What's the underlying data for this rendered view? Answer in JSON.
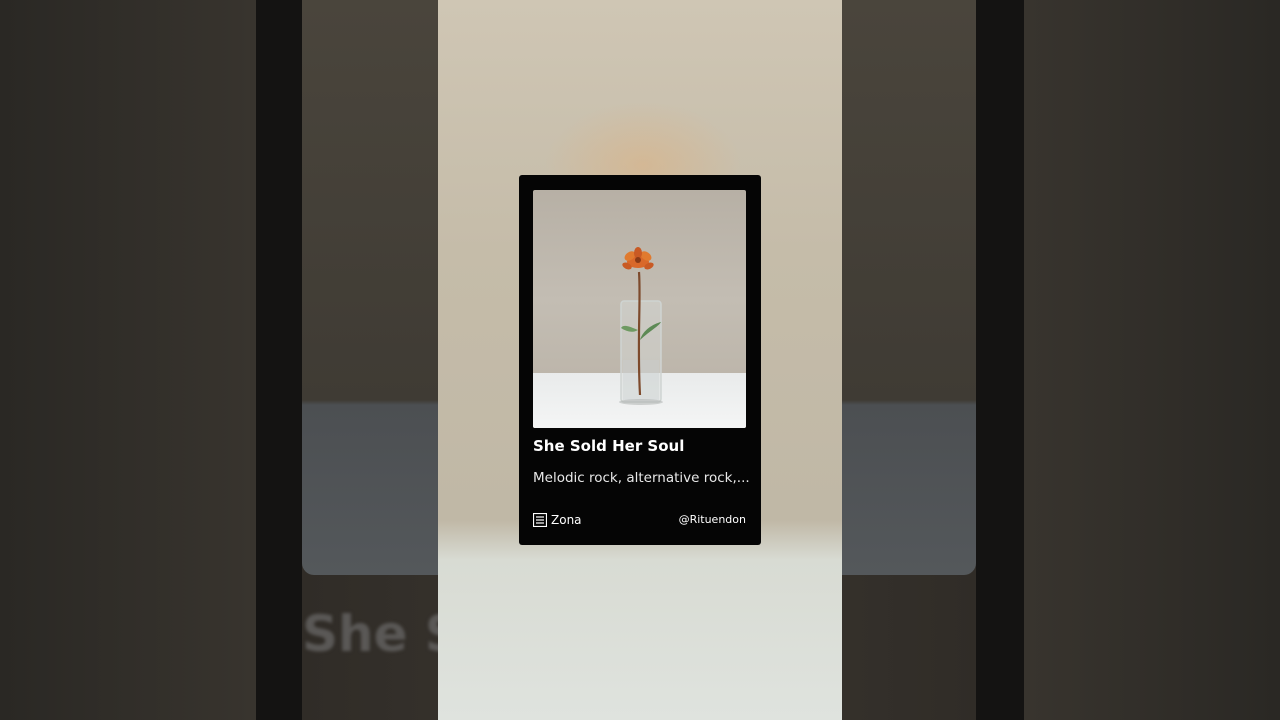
{
  "background": {
    "title_fragment": "She So"
  },
  "card": {
    "title": "She Sold Her Soul",
    "subtitle": "Melodic rock, alternative rock,...",
    "brand": {
      "name": "Zona",
      "icon": "zona-logo-icon"
    },
    "handle": "@Rituendon",
    "artwork_description_icon": "flower-in-glass-vase-image"
  },
  "colors": {
    "card_background": "#050505",
    "card_text": "#ffffff",
    "flower": "#d9682a"
  }
}
